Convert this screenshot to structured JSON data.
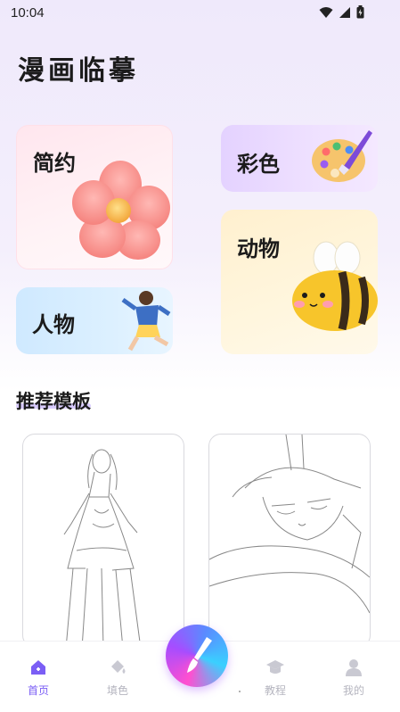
{
  "status_bar": {
    "time": "10:04"
  },
  "app": {
    "title": "漫画临摹"
  },
  "categories": {
    "simple": "简约",
    "color": "彩色",
    "animal": "动物",
    "person": "人物"
  },
  "recommend": {
    "title": "推荐模板"
  },
  "bottom_nav": {
    "home": "首页",
    "fill": "填色",
    "course": "教程",
    "mine": "我的"
  },
  "colors": {
    "accent": "#7b5ef5",
    "inactive": "#b5b5bf"
  }
}
